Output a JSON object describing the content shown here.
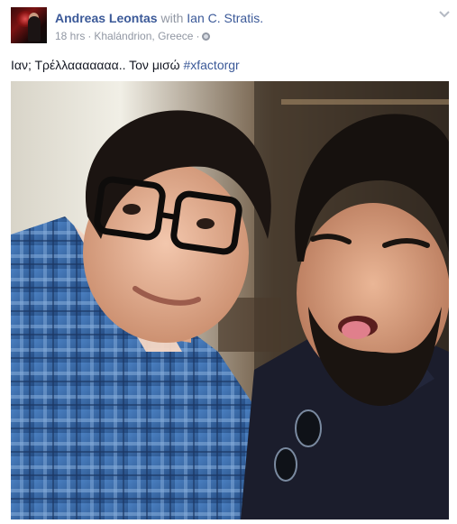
{
  "post": {
    "author_name": "Andreas Leontas",
    "with_text": "with",
    "tagged_name": "Ian C. Stratis.",
    "time": "18 hrs",
    "separator": "·",
    "location": "Khalándrion, Greece",
    "privacy_icon": "globe-icon",
    "menu_icon": "chevron-down-icon",
    "text": "Ιαν; Τρέλλααααααα.. Τον μισώ ",
    "hashtag": "#xfactorgr"
  },
  "colors": {
    "link": "#3b5998",
    "meta": "#9197a3",
    "body_text": "#141823"
  }
}
